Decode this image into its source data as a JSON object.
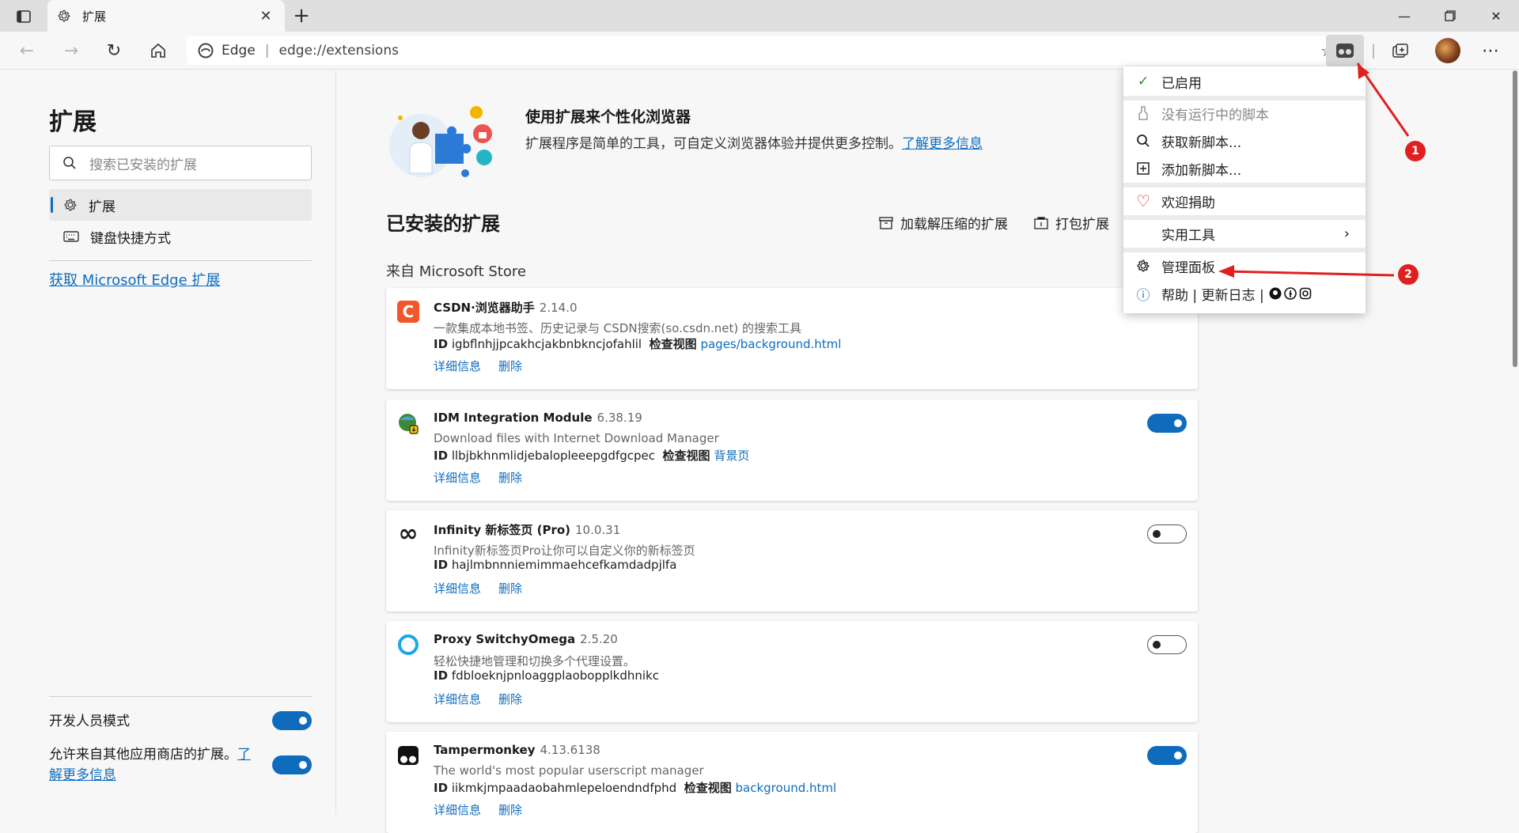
{
  "tab": {
    "title": "扩展"
  },
  "address": {
    "site": "Edge",
    "url": "edge://extensions"
  },
  "sidebar": {
    "title": "扩展",
    "search_placeholder": "搜索已安装的扩展",
    "items": [
      {
        "label": "扩展",
        "icon": "gear-icon",
        "active": true
      },
      {
        "label": "键盘快捷方式",
        "icon": "keyboard-icon",
        "active": false
      }
    ],
    "store_link": "获取 Microsoft Edge 扩展",
    "dev_mode_label": "开发人员模式",
    "dev_mode_on": true,
    "other_stores_label": "允许来自其他应用商店的扩展。",
    "other_stores_link": "了解更多信息",
    "other_stores_on": true
  },
  "hero": {
    "title": "使用扩展来个性化浏览器",
    "desc": "扩展程序是简单的工具，可自定义浏览器体验并提供更多控制。",
    "link": "了解更多信息"
  },
  "installed": {
    "title": "已安装的扩展",
    "load_unpacked": "加载解压缩的扩展",
    "pack": "打包扩展",
    "source": "来自 Microsoft Store"
  },
  "extensions": [
    {
      "name": "CSDN·浏览器助手",
      "version": "2.14.0",
      "desc": "一款集成本地书签、历史记录与 CSDN搜索(so.csdn.net) 的搜索工具",
      "id_label": "ID",
      "id": "igbflnhjjpcakhcjakbnbkncjofahlil",
      "inspect_label": "检查视图",
      "inspect_link": "pages/background.html",
      "details": "详细信息",
      "remove": "删除",
      "enabled": true
    },
    {
      "name": "IDM Integration Module",
      "version": "6.38.19",
      "desc": "Download files with Internet Download Manager",
      "id_label": "ID",
      "id": "llbjbkhnmlidjebalopleeepgdfgcpec",
      "inspect_label": "检查视图",
      "inspect_link": "背景页",
      "details": "详细信息",
      "remove": "删除",
      "enabled": true
    },
    {
      "name": "Infinity 新标签页 (Pro)",
      "version": "10.0.31",
      "desc": "Infinity新标签页Pro让你可以自定义你的新标签页",
      "id_label": "ID",
      "id": "hajlmbnnniemimmaehcefkamdadpjlfa",
      "inspect_label": "",
      "inspect_link": "",
      "details": "详细信息",
      "remove": "删除",
      "enabled": false
    },
    {
      "name": "Proxy SwitchyOmega",
      "version": "2.5.20",
      "desc": "轻松快捷地管理和切换多个代理设置。",
      "id_label": "ID",
      "id": "fdbloeknjpnloaggplaobopplkdhnikc",
      "inspect_label": "",
      "inspect_link": "",
      "details": "详细信息",
      "remove": "删除",
      "enabled": false
    },
    {
      "name": "Tampermonkey",
      "version": "4.13.6138",
      "desc": "The world's most popular userscript manager",
      "id_label": "ID",
      "id": "iikmkjmpaadaobahmlepeloendndfphd",
      "inspect_label": "检查视图",
      "inspect_link": "background.html",
      "details": "详细信息",
      "remove": "删除",
      "enabled": true
    }
  ],
  "popup": {
    "enabled": "已启用",
    "no_scripts": "没有运行中的脚本",
    "get_new": "获取新脚本...",
    "add_new": "添加新脚本...",
    "donate": "欢迎捐助",
    "utilities": "实用工具",
    "dashboard": "管理面板",
    "help_line": "帮助 | 更新日志 |"
  },
  "annotations": {
    "badge1": "1",
    "badge2": "2",
    "arrow_color": "#e02020"
  },
  "colors": {
    "accent": "#0f6cbd",
    "csdn": "#f1572a"
  }
}
